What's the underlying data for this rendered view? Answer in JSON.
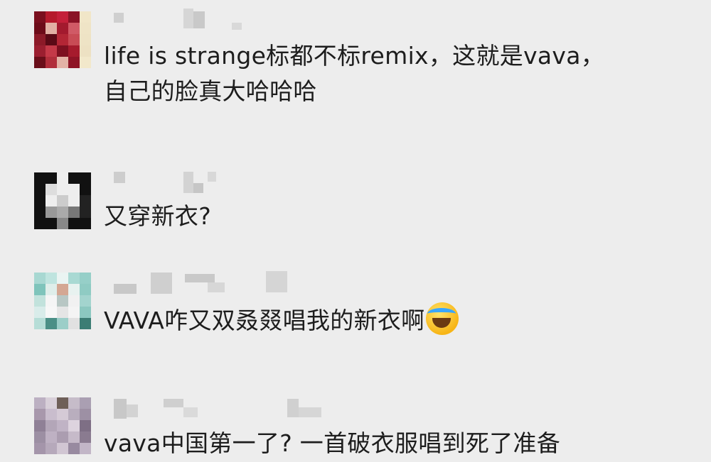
{
  "comments": [
    {
      "text_line1": "life is strange标都不标remix，这就是vava，",
      "text_line2": "自己的脸真大哈哈哈",
      "avatar_colors": [
        "#7a0f1e",
        "#b51a2c",
        "#c4203a",
        "#8a1326",
        "#f1e6c8",
        "#6d0c19",
        "#e2b0a4",
        "#a31a2e",
        "#d05a66",
        "#efe4c6",
        "#8c1a28",
        "#5a0a16",
        "#b32635",
        "#c84b55",
        "#eee3c5",
        "#9b1f30",
        "#c43948",
        "#7d1020",
        "#a61b2d",
        "#ede1c3",
        "#6a0f1a",
        "#b12e3b",
        "#e3b2a6",
        "#8f1426",
        "#f2e8cb"
      ]
    },
    {
      "text": "又穿新衣?",
      "avatar_colors": [
        "#111111",
        "#111111",
        "#eeeeee",
        "#111111",
        "#111111",
        "#111111",
        "#dddddd",
        "#eeeeee",
        "#eeeeee",
        "#111111",
        "#111111",
        "#eeeeee",
        "#cccccc",
        "#eeeeee",
        "#222222",
        "#111111",
        "#999999",
        "#aaaaaa",
        "#777777",
        "#222222",
        "#111111",
        "#111111",
        "#888888",
        "#111111",
        "#111111"
      ]
    },
    {
      "text": "VAVA咋又双叒叕唱我的新衣啊",
      "emoji": "face-with-tears-of-joy",
      "avatar_colors": [
        "#a8d8d2",
        "#bfe4df",
        "#eaf4f2",
        "#a9d9d3",
        "#96cfc8",
        "#7fc4bb",
        "#dfeeea",
        "#d4a793",
        "#e8f2f0",
        "#8fcbc3",
        "#c2e2dc",
        "#f5f5f5",
        "#b8c7c4",
        "#f1f1f1",
        "#a3d4ce",
        "#d9ecea",
        "#f7f7f7",
        "#e5e5e5",
        "#f4f4f4",
        "#8cc8c0",
        "#b6ddd7",
        "#4b8f86",
        "#9ccec8",
        "#e1e1e1",
        "#3c7d74"
      ]
    },
    {
      "text": "vava中国第一了? 一首破衣服唱到死了准备",
      "avatar_colors": [
        "#bcb0c2",
        "#d8cfd9",
        "#6e5f58",
        "#c6bcc9",
        "#aa9fb2",
        "#a898ac",
        "#c9bdcd",
        "#d5cad6",
        "#b9aebe",
        "#9d90a4",
        "#8f8096",
        "#b3a6b8",
        "#c0b3c5",
        "#ddd3de",
        "#7e6f85",
        "#9c8fa3",
        "#beb1c3",
        "#ab9db0",
        "#c6bac9",
        "#8a7b90",
        "#a495aa",
        "#b6a9bb",
        "#d1c6d3",
        "#988aa0",
        "#c2b6c7"
      ]
    }
  ]
}
